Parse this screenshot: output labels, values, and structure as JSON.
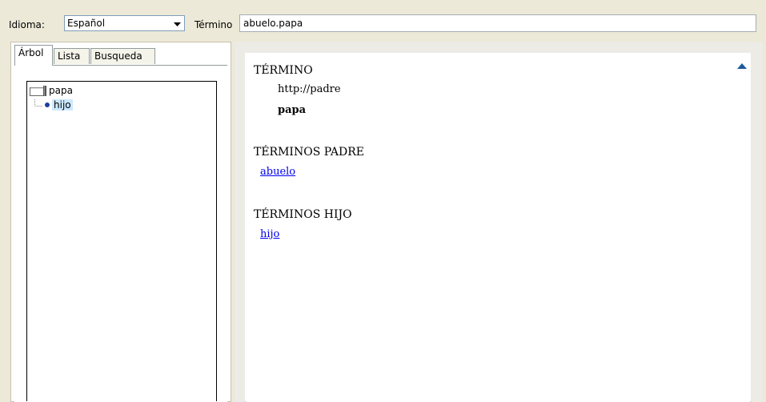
{
  "header": {
    "idioma_label": "Idioma:",
    "idioma_value": "Español",
    "termino_label": "Término",
    "termino_value": "abuelo.papa"
  },
  "tabs": [
    {
      "label": "Árbol",
      "active": true
    },
    {
      "label": "Lista",
      "active": false
    },
    {
      "label": "Busqueda",
      "active": false
    }
  ],
  "tree": {
    "root": {
      "label": "papa",
      "icon": "folder-icon"
    },
    "child": {
      "label": "hijo",
      "icon": "bullet-icon",
      "selected": true
    }
  },
  "detail": {
    "termino_heading": "TÉRMINO",
    "uri": "http://padre",
    "name": "papa",
    "padre_heading": "TÉRMINOS PADRE",
    "padre_link": "abuelo",
    "hijo_heading": "TÉRMINOS HIJO",
    "hijo_link": "hijo"
  },
  "colors": {
    "window_bg": "#ece9d8",
    "link": "#0000ee",
    "selection": "#cce8ff",
    "scroll_arrow": "#1c5a9e"
  }
}
